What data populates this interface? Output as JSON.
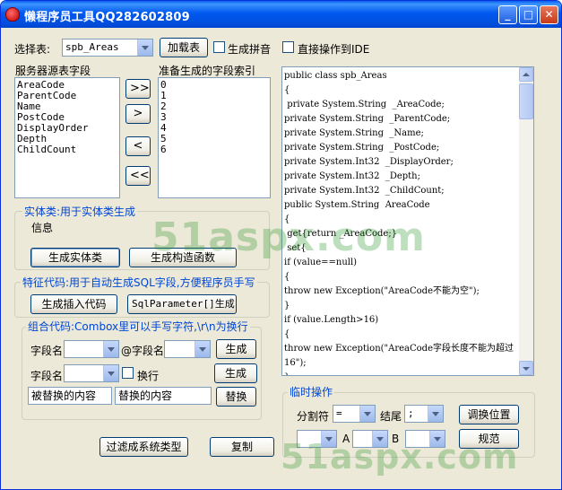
{
  "window": {
    "title": "懒程序员工具QQ282602809",
    "minimize_glyph": "_",
    "maximize_glyph": "□",
    "close_glyph": "✕"
  },
  "top": {
    "select_table_label": "选择表:",
    "table_value": "spb_Areas",
    "load_table_button": "加载表",
    "generate_pinyin_label": "生成拼音",
    "direct_ide_label": "直接操作到IDE"
  },
  "fields": {
    "source_label": "服务器源表字段",
    "source_items": [
      "AreaCode",
      "ParentCode",
      "Name",
      "PostCode",
      "DisplayOrder",
      "Depth",
      "ChildCount"
    ],
    "index_label": "准备生成的字段索引",
    "index_items": [
      "0",
      "1",
      "2",
      "3",
      "4",
      "5",
      "6"
    ],
    "move_all_right": ">>",
    "move_right": ">",
    "move_left": "<",
    "move_all_left": "<<"
  },
  "entity": {
    "title": "实体类:用于实体类生成",
    "info_label": "信息",
    "generate_entity_button": "生成实体类",
    "generate_ctor_button": "生成构造函数"
  },
  "feature": {
    "title": "特征代码:用于自动生成SQL字段,方便程序员手写",
    "insert_code_button": "生成插入代码",
    "sqlparam_button": "SqlParameter[]生成"
  },
  "combo": {
    "title": "组合代码:Combox里可以手写字符,\\r\\n为换行",
    "field_name_label": "字段名",
    "at_field_name_label": "@字段名",
    "generate_button": "生成",
    "field_name_label2": "字段名",
    "newline_label": "换行",
    "generate_button2": "生成",
    "replaced_text": "被替换的内容",
    "replace_text": "替换的内容",
    "replace_button": "替换"
  },
  "bottom": {
    "filter_button": "过滤成系统类型",
    "copy_button": "复制"
  },
  "temp": {
    "title": "临时操作",
    "separator_label": "分割符",
    "separator_value": "=",
    "end_label": "结尾",
    "end_value": ";",
    "swap_button": "调换位置",
    "a_label": "A",
    "b_label": "B",
    "normalize_button": "规范"
  },
  "code": {
    "lines": [
      "public class spb_Areas",
      "{",
      " private System.String  _AreaCode;",
      "private System.String  _ParentCode;",
      "private System.String  _Name;",
      "private System.String  _PostCode;",
      "private System.Int32  _DisplayOrder;",
      "private System.Int32  _Depth;",
      "private System.Int32  _ChildCount;",
      "public System.String  AreaCode",
      "{",
      " get{return _AreaCode;}",
      " set{",
      "if (value==null)",
      "{",
      "throw new Exception(\"AreaCode不能为空\");",
      "}",
      "if (value.Length>16)",
      "{",
      "throw new Exception(\"AreaCode字段长度不能为超过16\");",
      "}"
    ]
  },
  "watermarks": {
    "text_large": "51aspx.com",
    "text_small": "51aspx.com"
  }
}
